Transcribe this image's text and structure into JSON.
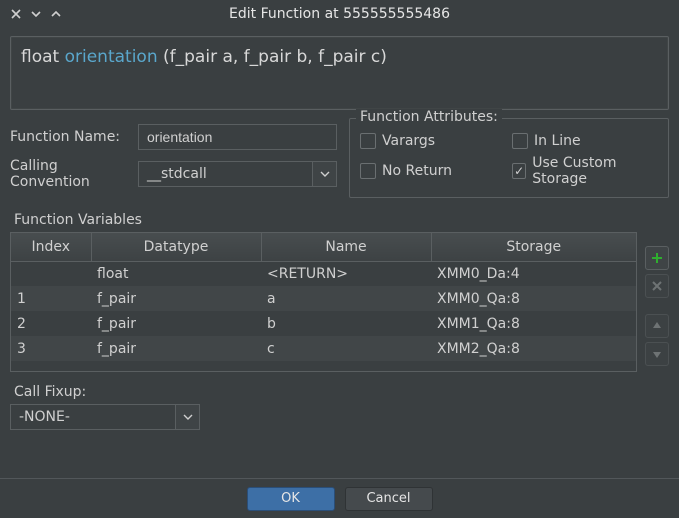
{
  "titlebar": {
    "title": "Edit Function at 555555555486"
  },
  "signature": {
    "return_type": "float",
    "name": "orientation",
    "params": "(f_pair a, f_pair b, f_pair c)"
  },
  "form": {
    "function_name_label": "Function Name:",
    "function_name_value": "orientation",
    "calling_convention_label": "Calling Convention",
    "calling_convention_value": "__stdcall"
  },
  "attributes": {
    "title": "Function Attributes:",
    "varargs": {
      "label": "Varargs",
      "checked": false
    },
    "inline": {
      "label": "In Line",
      "checked": false
    },
    "no_return": {
      "label": "No Return",
      "checked": false
    },
    "use_custom_storage": {
      "label": "Use Custom Storage",
      "checked": true
    }
  },
  "variables": {
    "section_label": "Function Variables",
    "headers": {
      "index": "Index",
      "datatype": "Datatype",
      "name": "Name",
      "storage": "Storage"
    },
    "rows": [
      {
        "index": "",
        "datatype": "float",
        "name": "<RETURN>",
        "storage": "XMM0_Da:4",
        "is_return": true
      },
      {
        "index": "1",
        "datatype": "f_pair",
        "name": "a",
        "storage": "XMM0_Qa:8",
        "is_return": false
      },
      {
        "index": "2",
        "datatype": "f_pair",
        "name": "b",
        "storage": "XMM1_Qa:8",
        "is_return": false
      },
      {
        "index": "3",
        "datatype": "f_pair",
        "name": "c",
        "storage": "XMM2_Qa:8",
        "is_return": false
      }
    ]
  },
  "call_fixup": {
    "label": "Call Fixup:",
    "value": "-NONE-"
  },
  "footer": {
    "ok": "OK",
    "cancel": "Cancel"
  }
}
